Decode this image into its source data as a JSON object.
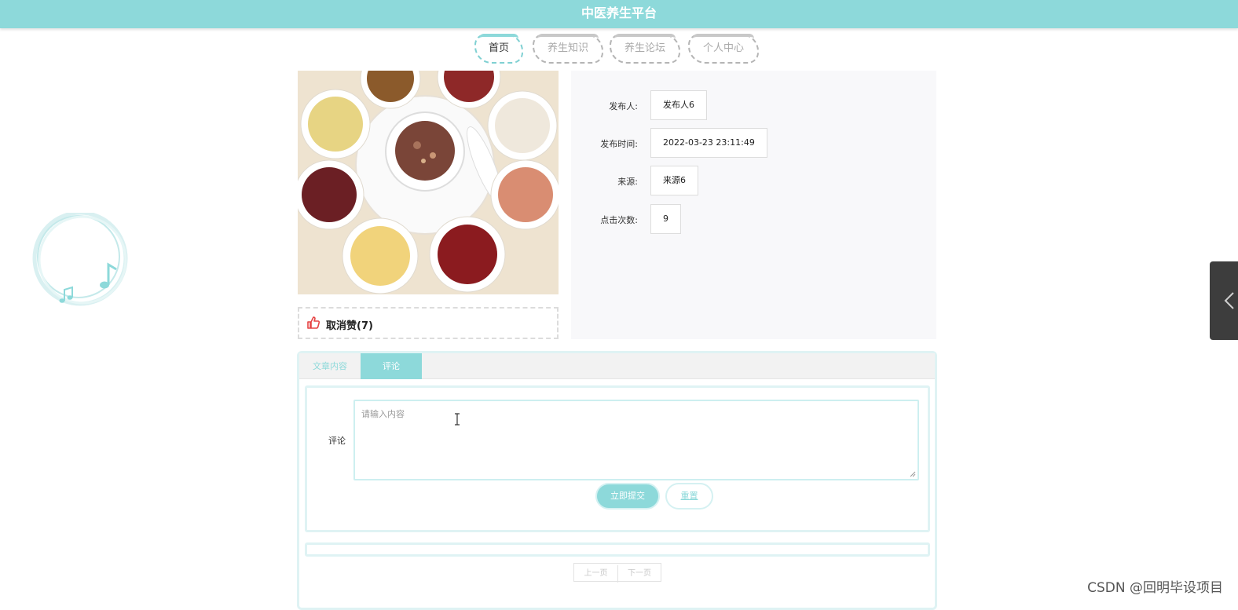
{
  "header": {
    "title": "中医养生平台"
  },
  "nav": {
    "items": [
      {
        "label": "首页",
        "active": true
      },
      {
        "label": "养生知识",
        "active": false
      },
      {
        "label": "养生论坛",
        "active": false
      },
      {
        "label": "个人中心",
        "active": false
      }
    ]
  },
  "article": {
    "image_icon": "food-bowls-photo",
    "like_label": "取消赞(7)",
    "like_icon": "thumbs-up-icon"
  },
  "info": {
    "publisher_label": "发布人:",
    "publisher_value": "发布人6",
    "time_label": "发布时间:",
    "time_value": "2022-03-23 23:11:49",
    "source_label": "来源:",
    "source_value": "来源6",
    "clicks_label": "点击次数:",
    "clicks_value": "9"
  },
  "tabs": {
    "content_label": "文章内容",
    "comment_label": "评论",
    "active": "comment"
  },
  "comment_form": {
    "label": "评论",
    "placeholder": "请输入内容",
    "submit_label": "立即提交",
    "reset_label": "重置"
  },
  "pager": {
    "prev_label": "上一页",
    "next_label": "下一页"
  },
  "watermark": "CSDN @回明毕设项目",
  "colors": {
    "accent": "#8dd9da",
    "panel_bg": "#f8f8fa",
    "side_handle": "#3d3d3d"
  }
}
